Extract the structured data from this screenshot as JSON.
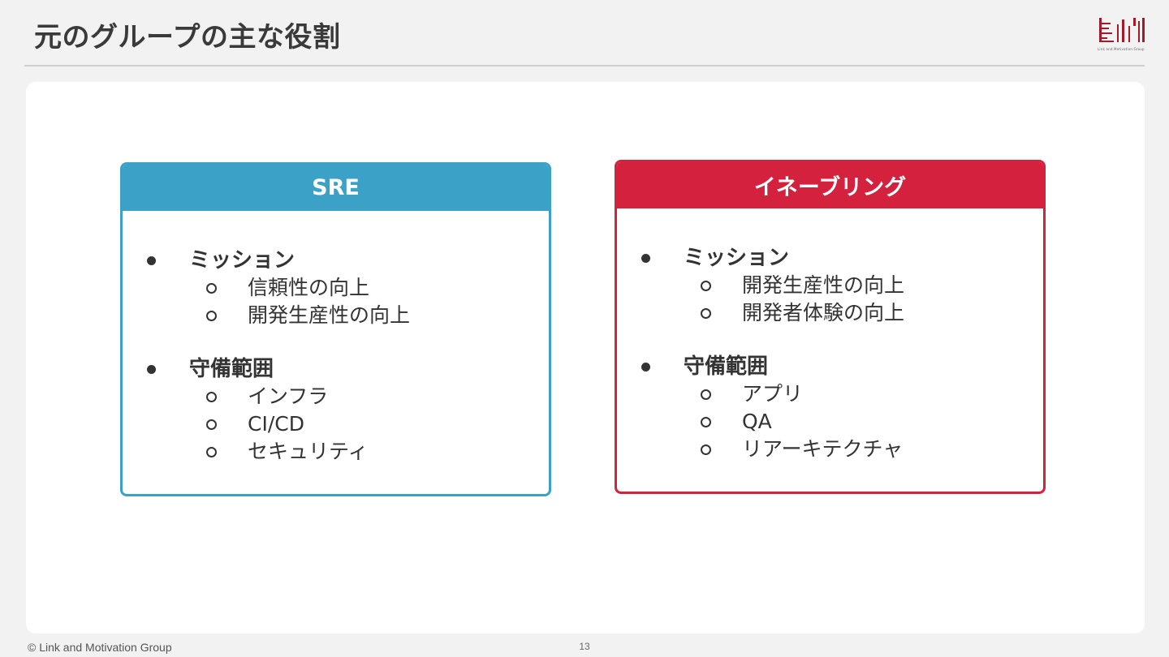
{
  "slide": {
    "title": "元のグループの主な役割",
    "page_number": "13",
    "footer": "© Link and Motivation Group",
    "logo_text": "Link and Motivation Group"
  },
  "colors": {
    "sre_accent": "#3ba1c6",
    "enabling_accent": "#d4213d",
    "text": "#333333",
    "background": "#f2f2f2"
  },
  "cards": [
    {
      "heading": "SRE",
      "groups": [
        {
          "label": "ミッション",
          "items": [
            "信頼性の向上",
            "開発生産性の向上"
          ]
        },
        {
          "label": "守備範囲",
          "items": [
            "インフラ",
            "CI/CD",
            "セキュリティ"
          ]
        }
      ]
    },
    {
      "heading": "イネーブリング",
      "groups": [
        {
          "label": "ミッション",
          "items": [
            "開発生産性の向上",
            "開発者体験の向上"
          ]
        },
        {
          "label": "守備範囲",
          "items": [
            "アプリ",
            "QA",
            "リアーキテクチャ"
          ]
        }
      ]
    }
  ]
}
